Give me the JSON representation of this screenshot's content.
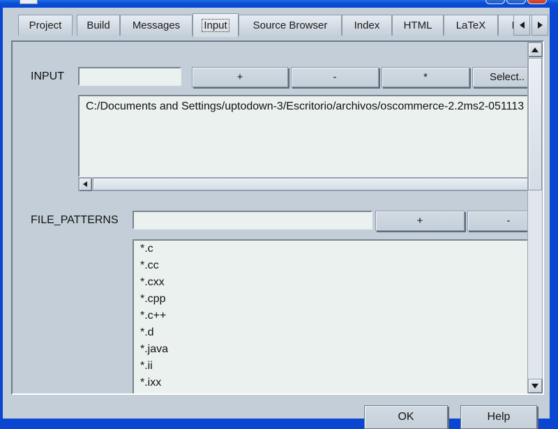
{
  "window": {
    "title": "",
    "controls": {
      "minimize_label": "_",
      "maximize_label": "□",
      "close_label": "×"
    }
  },
  "tabs": {
    "items": [
      {
        "label": "Project",
        "active": false
      },
      {
        "label": "Build",
        "active": false
      },
      {
        "label": "Messages",
        "active": false
      },
      {
        "label": "Input",
        "active": true
      },
      {
        "label": "Source Browser",
        "active": false
      },
      {
        "label": "Index",
        "active": false
      },
      {
        "label": "HTML",
        "active": false
      },
      {
        "label": "LaTeX",
        "active": false
      },
      {
        "label": "R",
        "active": false
      }
    ],
    "scroll_left_icon": "triangle-left-icon",
    "scroll_right_icon": "triangle-right-icon"
  },
  "input_section": {
    "label": "INPUT",
    "value": "",
    "placeholder": "",
    "buttons": {
      "add": "+",
      "remove": "-",
      "wildcard": "*",
      "select": "Select.."
    },
    "list": [
      "C:/Documents and Settings/uptodown-3/Escritorio/archivos/oscommerce-2.2ms2-051113"
    ],
    "hscroll_left_icon": "triangle-left-icon"
  },
  "file_patterns_section": {
    "label": "FILE_PATTERNS",
    "value": "",
    "placeholder": "",
    "buttons": {
      "add": "+",
      "remove": "-"
    },
    "list": [
      "*.c",
      "*.cc",
      "*.cxx",
      "*.cpp",
      "*.c++",
      "*.d",
      "*.java",
      "*.ii",
      "*.ixx"
    ]
  },
  "scrollbar": {
    "up_icon": "triangle-up-icon",
    "down_icon": "triangle-down-icon"
  },
  "footer": {
    "ok_label": "OK",
    "help_label": "Help"
  },
  "colors": {
    "window_frame": "#0a46d2",
    "dialog_bg": "#c3ced8",
    "field_bg": "#eaf1ee",
    "text": "#111111",
    "border": "#8b98a7"
  }
}
